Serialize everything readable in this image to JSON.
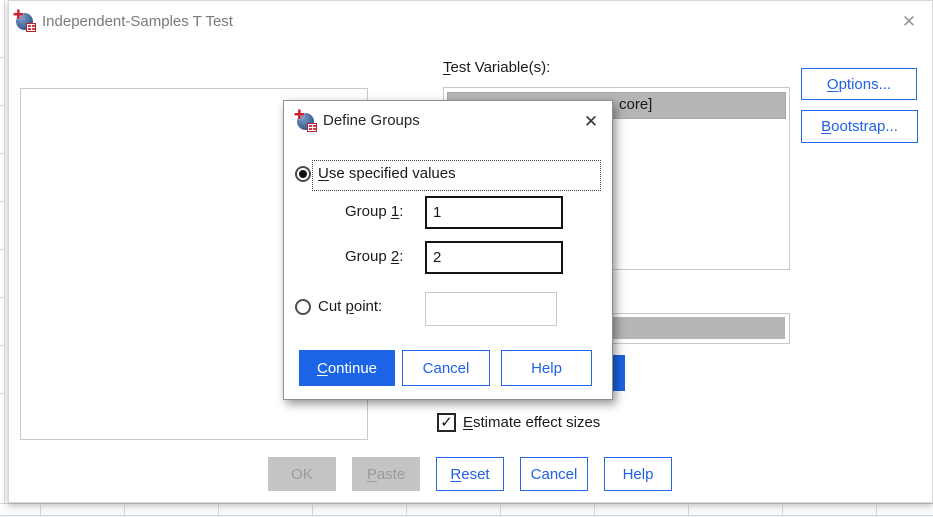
{
  "colors": {
    "accent": "#1c64e6",
    "accent_border": "#2468e8",
    "disabled_bg": "#c4c4c4",
    "disabled_text": "#9b9b9b",
    "selected_row_bg": "#b5b5b5",
    "title_text": "#7a7a7a"
  },
  "main_window": {
    "title": "Independent-Samples T Test",
    "close_glyph": "✕",
    "test_variables_label": {
      "key": "T",
      "post": "est Variable(s):"
    },
    "test_variables_selected_visible_text": "core]",
    "options_button": {
      "key": "O",
      "post": "ptions..."
    },
    "bootstrap_button": {
      "key": "B",
      "post": "ootstrap..."
    },
    "estimate_effect_sizes": {
      "key": "E",
      "post": "stimate effect sizes",
      "check_glyph": "✓"
    },
    "ok_button": "OK",
    "paste_button": {
      "key": "P",
      "post": "aste"
    },
    "reset_button": {
      "key": "R",
      "post": "eset"
    },
    "cancel_button": "Cancel",
    "help_button": "Help"
  },
  "define_groups_dialog": {
    "title": "Define Groups",
    "close_glyph": "✕",
    "use_specified_values": {
      "key": "U",
      "post": "se specified values"
    },
    "group1": {
      "label": {
        "pre": "Group ",
        "key": "1",
        "post": ":"
      },
      "value": "1"
    },
    "group2": {
      "label": {
        "pre": "Group ",
        "key": "2",
        "post": ":"
      },
      "value": "2"
    },
    "cut_point": {
      "label": {
        "pre": "Cut ",
        "key": "p",
        "post": "oint:"
      },
      "value": ""
    },
    "continue_button": {
      "key": "C",
      "post": "ontinue"
    },
    "cancel_button": "Cancel",
    "help_button": "Help"
  }
}
